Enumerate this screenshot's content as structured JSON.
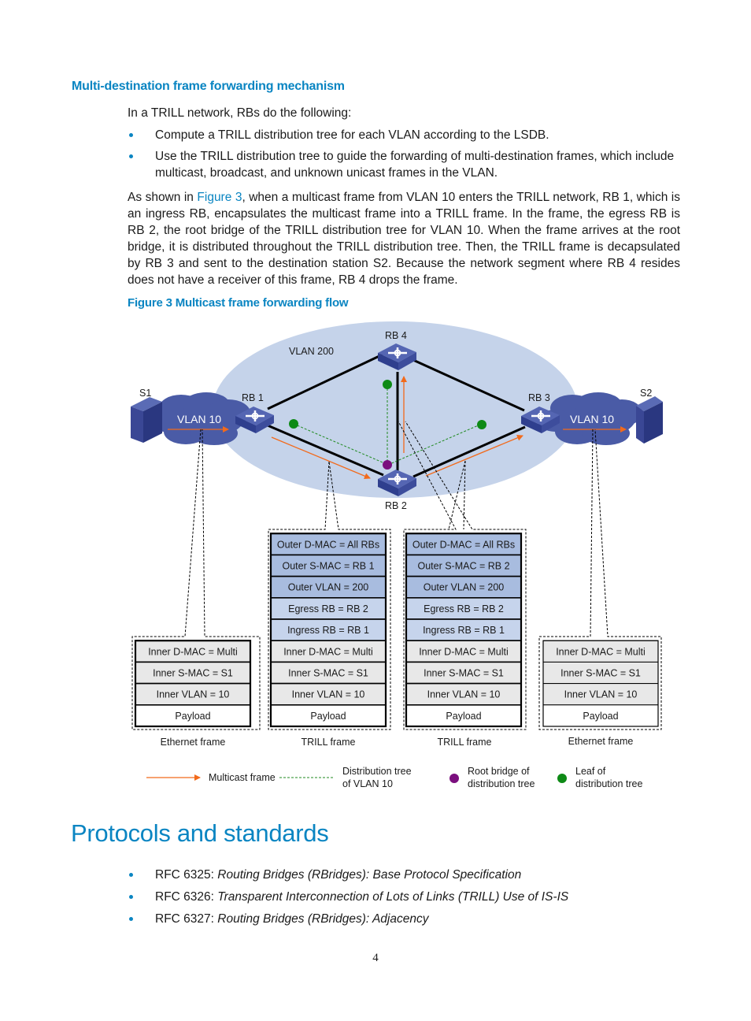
{
  "section": {
    "heading": "Multi-destination frame forwarding mechanism",
    "intro": "In a TRILL network, RBs do the following:",
    "bullets": [
      "Compute a TRILL distribution tree for each VLAN according to the LSDB.",
      "Use the TRILL distribution tree to guide the forwarding of multi-destination frames, which include multicast, broadcast, and unknown unicast frames in the VLAN."
    ],
    "paragraph_before_link": "As shown in ",
    "paragraph_link": "Figure 3",
    "paragraph_after_link": ", when a multicast frame from VLAN 10 enters the TRILL network, RB 1, which is an ingress RB, encapsulates the multicast frame into a TRILL frame. In the frame, the egress RB is RB 2, the root bridge of the TRILL distribution tree for VLAN 10. When the frame arrives at the root bridge, it is distributed throughout the TRILL distribution tree. Then, the TRILL frame is decapsulated by RB 3 and sent to the destination station S2. Because the network segment where RB 4 resides does not have a receiver of this frame, RB 4 drops the frame."
  },
  "figure": {
    "caption": "Figure 3 Multicast frame forwarding flow",
    "colors": {
      "vlan200_area": "#c5d3ea",
      "cloud": "#4a5ba6",
      "switch": "#3e4f9e",
      "multicast_arrow": "#f26a1b",
      "tree_line": "#1f8a1f",
      "root_dot": "#7b0f7e",
      "leaf_dot": "#0e8a16",
      "outer_header": "#a8bcdf",
      "trill_header": "#c6d4ec",
      "inner_header": "#e8e8e8"
    },
    "labels": {
      "vlan200": "VLAN 200",
      "s1": "S1",
      "s2": "S2",
      "vlan10_left": "VLAN 10",
      "vlan10_right": "VLAN 10",
      "rb1": "RB 1",
      "rb2": "RB 2",
      "rb3": "RB 3",
      "rb4": "RB 4",
      "switch_text": "SWITCH"
    },
    "frames": [
      {
        "caption": "Ethernet frame",
        "fields": [
          {
            "text": "Inner D-MAC = Multi",
            "kind": "inner"
          },
          {
            "text": "Inner S-MAC = S1",
            "kind": "inner"
          },
          {
            "text": "Inner VLAN = 10",
            "kind": "inner"
          },
          {
            "text": "Payload",
            "kind": "payload"
          }
        ]
      },
      {
        "caption": "TRILL frame",
        "fields": [
          {
            "text": "Outer D-MAC = All RBs",
            "kind": "outer"
          },
          {
            "text": "Outer S-MAC = RB 1",
            "kind": "outer"
          },
          {
            "text": "Outer VLAN = 200",
            "kind": "outer"
          },
          {
            "text": "Egress RB = RB 2",
            "kind": "trill"
          },
          {
            "text": "Ingress RB = RB 1",
            "kind": "trill"
          },
          {
            "text": "Inner D-MAC = Multi",
            "kind": "inner"
          },
          {
            "text": "Inner S-MAC = S1",
            "kind": "inner"
          },
          {
            "text": "Inner VLAN = 10",
            "kind": "inner"
          },
          {
            "text": "Payload",
            "kind": "payload"
          }
        ]
      },
      {
        "caption": "TRILL frame",
        "fields": [
          {
            "text": "Outer D-MAC = All RBs",
            "kind": "outer"
          },
          {
            "text": "Outer S-MAC = RB 2",
            "kind": "outer"
          },
          {
            "text": "Outer VLAN = 200",
            "kind": "outer"
          },
          {
            "text": "Egress RB = RB 2",
            "kind": "trill"
          },
          {
            "text": "Ingress RB = RB 1",
            "kind": "trill"
          },
          {
            "text": "Inner D-MAC = Multi",
            "kind": "inner"
          },
          {
            "text": "Inner S-MAC = S1",
            "kind": "inner"
          },
          {
            "text": "Inner VLAN = 10",
            "kind": "inner"
          },
          {
            "text": "Payload",
            "kind": "payload"
          }
        ]
      },
      {
        "caption": "Ethernet frame",
        "fields": [
          {
            "text": "Inner D-MAC = Multi",
            "kind": "inner"
          },
          {
            "text": "Inner S-MAC = S1",
            "kind": "inner"
          },
          {
            "text": "Inner VLAN = 10",
            "kind": "inner"
          },
          {
            "text": "Payload",
            "kind": "payload"
          }
        ]
      }
    ],
    "legend": {
      "multicast_frame": "Multicast frame",
      "tree_line1": "Distribution tree",
      "tree_line2": "of VLAN 10",
      "root_line1": "Root bridge of",
      "root_line2": "distribution tree",
      "leaf_line1": "Leaf of",
      "leaf_line2": "distribution tree"
    }
  },
  "standards": {
    "heading": "Protocols and standards",
    "items": [
      {
        "id": "RFC 6325: ",
        "title": "Routing Bridges (RBridges): Base Protocol Specification"
      },
      {
        "id": "RFC 6326: ",
        "title": "Transparent Interconnection of Lots of Links (TRILL) Use of IS-IS"
      },
      {
        "id": "RFC 6327: ",
        "title": "Routing Bridges (RBridges): Adjacency"
      }
    ]
  },
  "page_number": "4"
}
